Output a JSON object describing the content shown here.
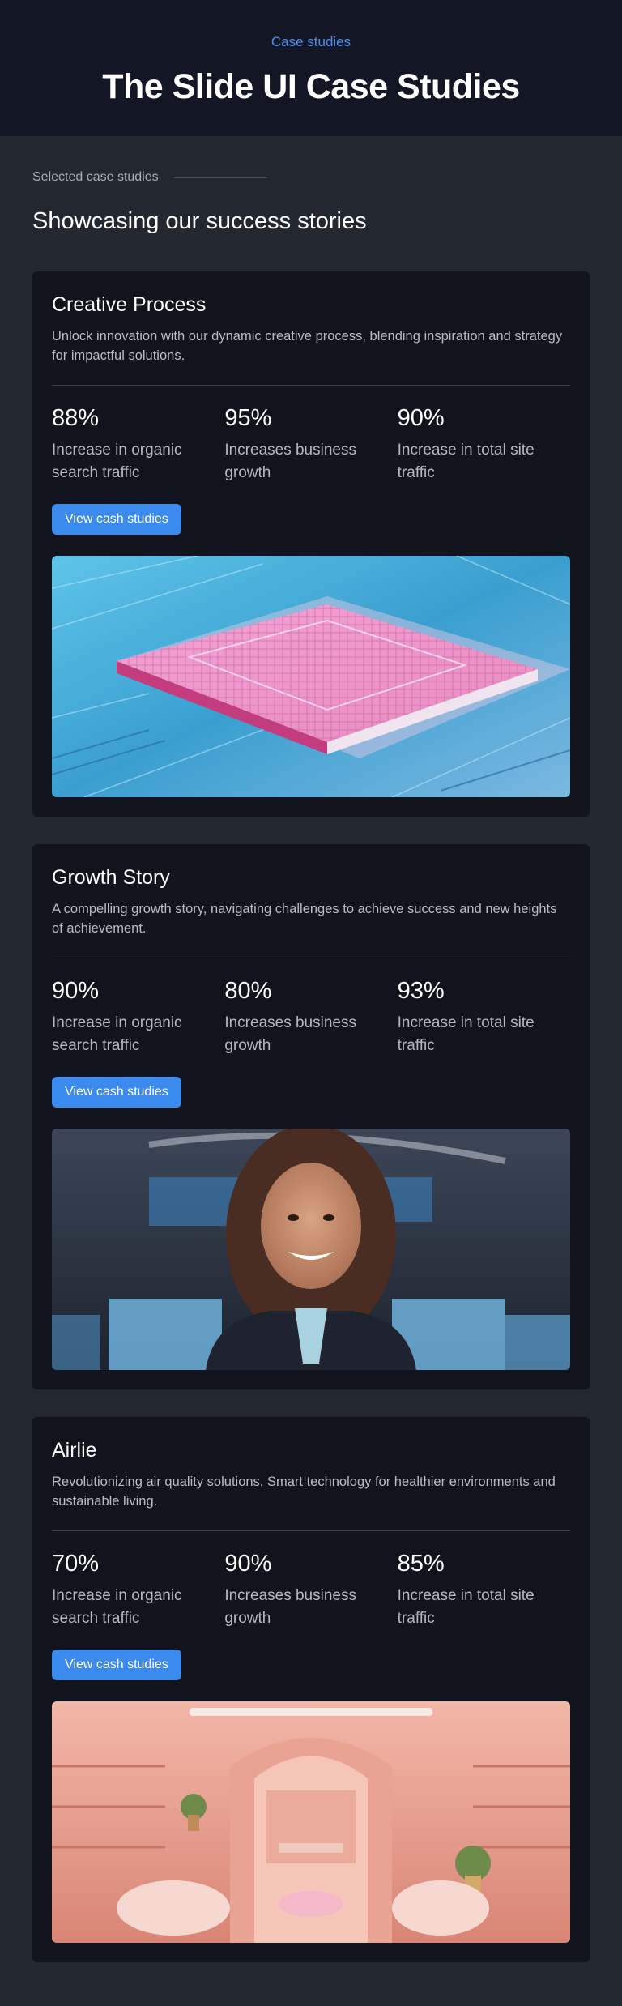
{
  "hero": {
    "eyebrow": "Case studies",
    "title": "The Slide UI Case Studies"
  },
  "section": {
    "label": "Selected case studies",
    "title": "Showcasing our success stories"
  },
  "cards": [
    {
      "title": "Creative Process",
      "description": "Unlock innovation with our dynamic creative process, blending inspiration and strategy for impactful solutions.",
      "stats": [
        {
          "value": "88%",
          "label": "Increase in organic search traffic"
        },
        {
          "value": "95%",
          "label": "Increases business growth"
        },
        {
          "value": "90%",
          "label": "Increase in total site traffic"
        }
      ],
      "button": "View cash studies",
      "image": "circuit-chip-image"
    },
    {
      "title": "Growth Story",
      "description": "A compelling growth story, navigating challenges to achieve success and new heights of achievement.",
      "stats": [
        {
          "value": "90%",
          "label": "Increase in organic search traffic"
        },
        {
          "value": "80%",
          "label": "Increases business growth"
        },
        {
          "value": "93%",
          "label": "Increase in total site traffic"
        }
      ],
      "button": "View cash studies",
      "image": "smiling-woman-office-image"
    },
    {
      "title": "Airlie",
      "description": "Revolutionizing air quality solutions. Smart technology for healthier environments and sustainable living.",
      "stats": [
        {
          "value": "70%",
          "label": "Increase in organic search traffic"
        },
        {
          "value": "90%",
          "label": "Increases business growth"
        },
        {
          "value": "85%",
          "label": "Increase in total site traffic"
        }
      ],
      "button": "View cash studies",
      "image": "pink-store-interior-image"
    }
  ],
  "colors": {
    "accent": "#3b8aed",
    "hero_bg": "#121625",
    "page_bg": "#23272f",
    "card_bg": "#11141c"
  }
}
